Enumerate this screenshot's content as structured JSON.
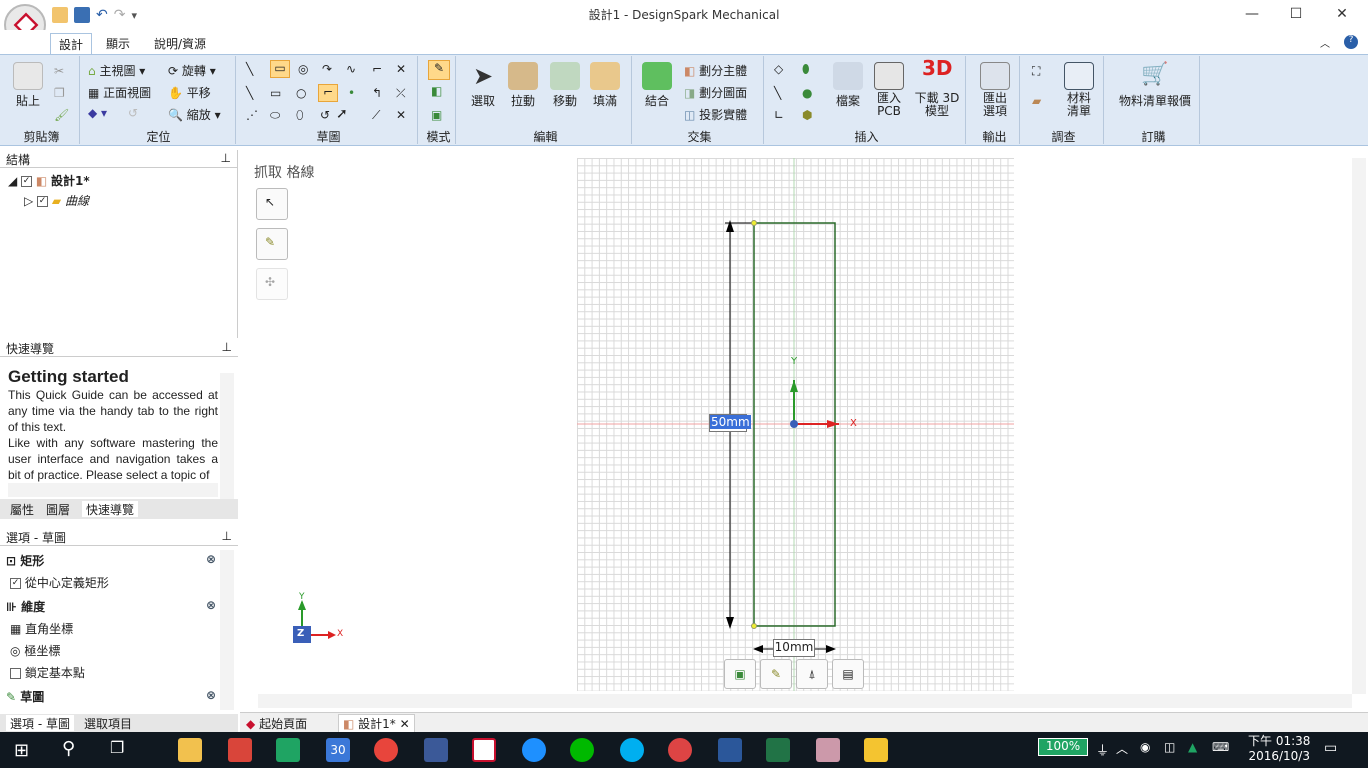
{
  "window": {
    "title": "設計1 - DesignSpark Mechanical",
    "minimize": "—",
    "maximize": "☐",
    "close": "✕"
  },
  "ribbon_tabs": [
    "設計",
    "顯示",
    "說明/資源"
  ],
  "ribbon": {
    "clipboard": {
      "label": "剪貼簿",
      "paste": "貼上"
    },
    "orient": {
      "label": "定位",
      "home": "主視圖",
      "front": "正面視圖",
      "rotate": "旋轉",
      "pan": "平移",
      "zoom": "縮放"
    },
    "sketch": {
      "label": "草圖"
    },
    "mode": {
      "label": "模式"
    },
    "edit": {
      "label": "編輯",
      "select": "選取",
      "pull": "拉動",
      "move": "移動",
      "fill": "填滿"
    },
    "intersect": {
      "label": "交集",
      "combine": "結合",
      "split_body": "劃分主體",
      "split_face": "劃分圖面",
      "project": "投影實體"
    },
    "insert": {
      "label": "插入",
      "file": "檔案",
      "import_pcb": "匯入\nPCB",
      "download_3d": "下載 3D\n模型"
    },
    "output": {
      "label": "輸出",
      "export": "匯出\n選項"
    },
    "survey": {
      "label": "調查",
      "bom": "材料\n清單"
    },
    "order": {
      "label": "訂購",
      "bom_quote": "物料清單報價"
    }
  },
  "structure": {
    "title": "結構",
    "root": "設計1*",
    "child": "曲線"
  },
  "quick_nav": {
    "title": "快速導覽",
    "heading": "Getting started",
    "body": "This Quick Guide can be accessed at any time via the handy tab to the right of this text.\nLike with any software mastering the user interface and navigation takes a bit of practice. Please select a topic of",
    "tabs": [
      "屬性",
      "圖層",
      "快速導覽"
    ]
  },
  "options": {
    "title": "選項 - 草圖",
    "rect_section": "矩形",
    "from_center": "從中心定義矩形",
    "dimension_section": "維度",
    "cartesian": "直角坐標",
    "polar": "極坐標",
    "lock_base": "鎖定基本點",
    "sketch_section": "草圖",
    "tabs": [
      "選項 - 草圖",
      "選取項目"
    ]
  },
  "canvas": {
    "snap_label": "抓取 格線",
    "dim_height": "50mm",
    "dim_width": "10mm",
    "axis_x": "X",
    "axis_y": "Y",
    "axis_z": "Z"
  },
  "doc_tabs": [
    "起始頁面",
    "設計1*"
  ],
  "taskbar": {
    "battery": "100%",
    "time": "下午 01:38",
    "date": "2016/10/3",
    "calendar": "30"
  }
}
